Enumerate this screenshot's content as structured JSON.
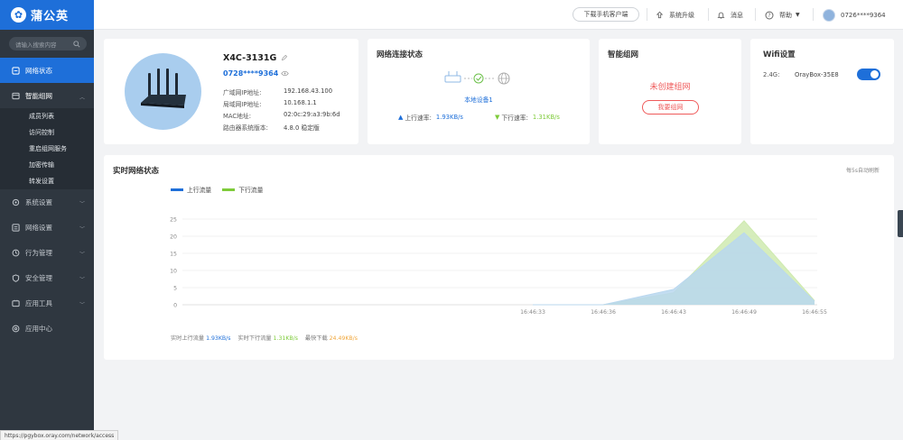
{
  "brand": {
    "name": "蒲公英"
  },
  "sidebar": {
    "search_placeholder": "请输入搜索内容",
    "items": [
      {
        "label": "网络状态",
        "active": true
      },
      {
        "label": "智能组网",
        "open": true
      },
      {
        "label": "系统设置"
      },
      {
        "label": "网络设置"
      },
      {
        "label": "行为管理"
      },
      {
        "label": "安全管理"
      },
      {
        "label": "应用工具"
      },
      {
        "label": "应用中心"
      }
    ],
    "subitems": [
      "成员列表",
      "访问控制",
      "重启组网服务",
      "加密传输",
      "转发设置"
    ]
  },
  "topbar": {
    "download_label": "下载手机客户端",
    "upgrade_label": "系统升级",
    "message_label": "消息",
    "help_label": "帮助",
    "user_label": "0726****9364"
  },
  "device": {
    "name": "X4C-3131G",
    "sn": "0728****9364",
    "rows": [
      {
        "key": "广域网IP地址:",
        "value": "192.168.43.100"
      },
      {
        "key": "局域网IP地址:",
        "value": "10.168.1.1"
      },
      {
        "key": "MAC地址:",
        "value": "02:0c:29:a3:9b:6d"
      },
      {
        "key": "路由器系统版本:",
        "value": "4.8.0 稳定版"
      }
    ]
  },
  "network": {
    "title": "网络连接状态",
    "local_label": "本地设备1",
    "up_label": "上行速率:",
    "up_value": "1.93KB/s",
    "down_label": "下行速率:",
    "down_value": "1.31KB/s"
  },
  "mesh": {
    "title": "智能组网",
    "status": "未创建组网",
    "button": "我要组网"
  },
  "wifi": {
    "title": "Wifi设置",
    "band": "2.4G:",
    "ssid": "OrayBox-35E8",
    "enabled": true
  },
  "realtime": {
    "title": "实时网络状态",
    "refresh_note": "每5s自动刷新",
    "footer": {
      "up_label": "实时上行流量",
      "up_value": "1.93KB/s",
      "down_label": "实时下行流量",
      "down_value": "1.31KB/s",
      "peak_label": "最快下载",
      "peak_value": "24.49KB/s"
    }
  },
  "chart_data": {
    "type": "area",
    "x": [
      "16:46:33",
      "16:46:36",
      "16:46:43",
      "16:46:49",
      "16:46:55"
    ],
    "ylim": [
      0,
      25
    ],
    "yticks": [
      0,
      5,
      10,
      15,
      20,
      25
    ],
    "series": [
      {
        "name": "上行流量",
        "color": "#1e6fd9",
        "fill": "#b9d7ee",
        "values": [
          0,
          0,
          4.5,
          21,
          1
        ]
      },
      {
        "name": "下行流量",
        "color": "#7ecb3a",
        "fill": "#cfeab0",
        "values": [
          0,
          0,
          3.5,
          24.5,
          1.2
        ]
      }
    ]
  },
  "statusbar": {
    "url": "https://pgybox.oray.com/network/access"
  },
  "colors": {
    "accent": "#1e6fd9",
    "sidebar_bg": "#2f3740",
    "up": "#1e6fd9",
    "down": "#7ecb3a",
    "peak": "#f0a63a",
    "alert": "#ef5a5a"
  }
}
